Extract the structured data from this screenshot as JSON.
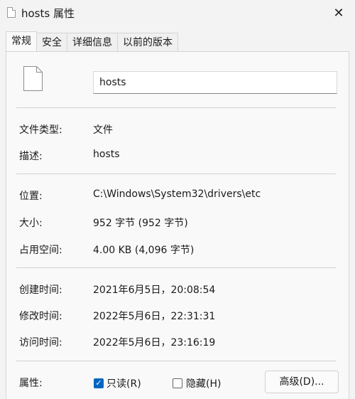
{
  "window": {
    "title": "hosts 属性",
    "close_glyph": "✕"
  },
  "tabs": [
    {
      "label": "常规",
      "active": true
    },
    {
      "label": "安全",
      "active": false
    },
    {
      "label": "详细信息",
      "active": false
    },
    {
      "label": "以前的版本",
      "active": false
    }
  ],
  "general": {
    "file_name": "hosts",
    "file_type_label": "文件类型:",
    "file_type_value": "文件",
    "description_label": "描述:",
    "description_value": "hosts",
    "location_label": "位置:",
    "location_value": "C:\\Windows\\System32\\drivers\\etc",
    "size_label": "大小:",
    "size_value": "952 字节 (952 字节)",
    "size_on_disk_label": "占用空间:",
    "size_on_disk_value": "4.00 KB (4,096 字节)",
    "created_label": "创建时间:",
    "created_value": "2021年6月5日，20:08:54",
    "modified_label": "修改时间:",
    "modified_value": "2022年5月6日，22:31:31",
    "accessed_label": "访问时间:",
    "accessed_value": "2022年5月6日，23:16:19",
    "attributes_label": "属性:",
    "readonly_label": "只读(R)",
    "readonly_checked": true,
    "hidden_label": "隐藏(H)",
    "hidden_checked": false,
    "advanced_button": "高级(D)..."
  },
  "icons": {
    "title": "document-icon",
    "file": "file-icon",
    "check": "✓"
  }
}
